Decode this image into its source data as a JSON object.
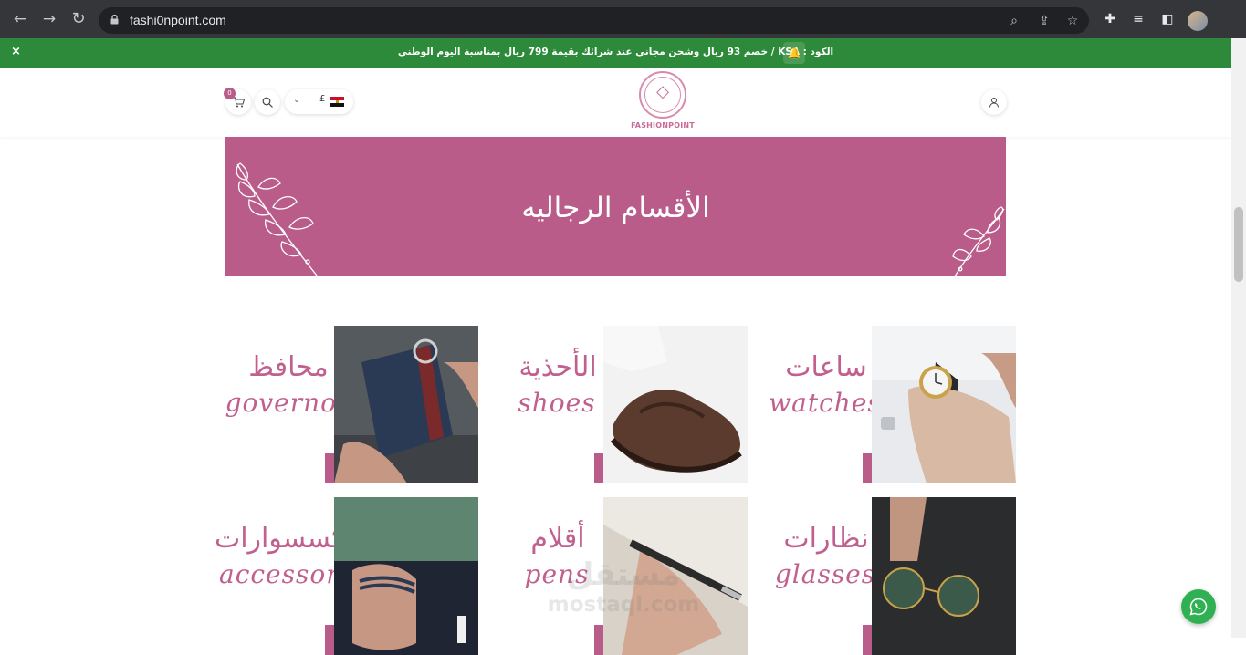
{
  "browser": {
    "url": "fashi0npoint.com",
    "icons": [
      "back-icon",
      "forward-icon",
      "reload-icon",
      "lock-icon",
      "zoom-icon",
      "share-icon",
      "star-icon",
      "extensions-icon",
      "media-icon",
      "sidepanel-icon",
      "profile-avatar"
    ]
  },
  "announcement": {
    "text": "الكود : KSA / خصم 93 ريال وشحن مجاني عند شرائك بقيمة 799 ريال بمناسبة اليوم الوطني",
    "close": "×"
  },
  "header": {
    "logo_text": "FASHIONPOINT",
    "cart_count": "0",
    "currency_symbol": "£",
    "brand_color": "#b95c8a"
  },
  "banner": {
    "title": "الأقسام الرجاليه"
  },
  "categories": [
    {
      "ar": "ساعات",
      "en": "watches"
    },
    {
      "ar": "الأحذية",
      "en": "shoes"
    },
    {
      "ar": "محافظ",
      "en": "governor"
    },
    {
      "ar": "نظارات",
      "en": "glasses"
    },
    {
      "ar": "أقلام",
      "en": "pens"
    },
    {
      "ar": "اكسسوارات",
      "en": "accessories"
    }
  ],
  "watermark": {
    "ar": "مستقل",
    "en": "mostaql.com"
  }
}
